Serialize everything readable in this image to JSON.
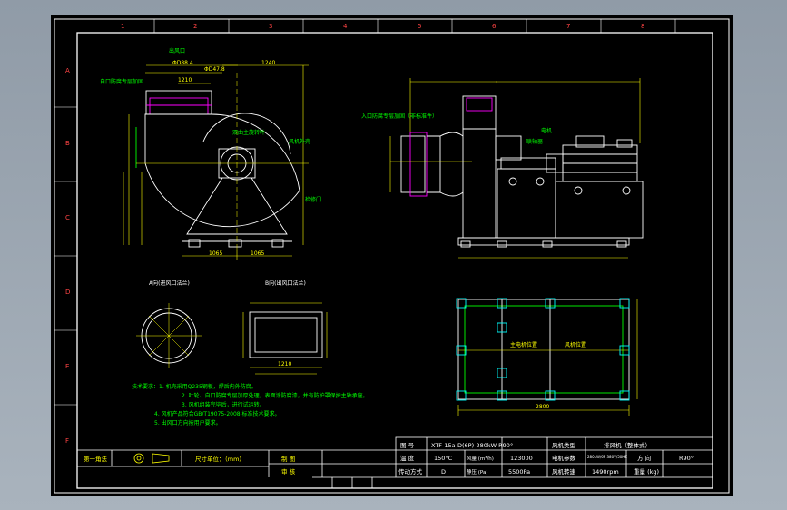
{
  "zones": {
    "columns": [
      "1",
      "2",
      "3",
      "4",
      "5",
      "6",
      "7",
      "8"
    ],
    "rows": [
      "A",
      "B",
      "C",
      "D",
      "E",
      "F"
    ]
  },
  "side_view": {
    "dims": [
      "ΦD88.4",
      "ΦD47.8",
      "1240",
      "1210"
    ],
    "notes": [
      "出风口",
      "自口防腐专层加固",
      "双曲主旋转叶",
      "风机外壳",
      "检修门"
    ],
    "base_dims": [
      "1065",
      "1065"
    ]
  },
  "front_view": {
    "notes": [
      "入口防腐专层加固（非标准件）",
      "联轴器",
      "电机"
    ]
  },
  "detail_a": {
    "title": "A向(进风口法兰)"
  },
  "detail_b": {
    "title": "B向(出风口法兰)",
    "dim": "1210"
  },
  "plan_view": {
    "labels": [
      "主电机位置",
      "风机位置"
    ],
    "dim": "2800"
  },
  "tech_notes": {
    "title": "技术要求",
    "lines": [
      "技术要求：1. 机壳采用Q235钢板，焊后内外防腐。",
      "2. 叶轮、自口防腐专层加厚处理，表面涂防腐漆，并有防护罩保护主轴承座。",
      "3. 风机组装完毕后，进行试运转。",
      "4. 风机产品符合GB/T19075-2008 标准技术要求。",
      "5. 出风口方向按用户要求。"
    ]
  },
  "title_block": {
    "left_label": "第一角法",
    "unit_label": "尺寸单位：（mm）",
    "drawn": "制 图",
    "checked": "审 核",
    "rows": [
      {
        "k1": "图 号",
        "v1": "XTF-15a-D(6P)-280kW-R90°",
        "k2": "风机类型",
        "v2": "排风机（整体式）"
      },
      {
        "k1": "温 度",
        "v1": "150°C",
        "k2": "风量 (m³/h)",
        "v2": "123000",
        "k3": "电机参数",
        "v3": "280kW/6P 380V/50HZ",
        "k4": "方 向",
        "v4": "R90°"
      },
      {
        "k1": "传动方式",
        "v1": "D",
        "k2": "静压 (Pa)",
        "v2": "5500Pa",
        "k3": "风机转速",
        "v3": "1490rpm",
        "k4": "重量 (kg)",
        "v4": ""
      }
    ]
  },
  "colors": {
    "background": "#000000",
    "frame": "#ffffff",
    "dimension": "#ffff00",
    "annotation": "#00ff00",
    "cyan": "#00ffff",
    "magenta": "#ff00ff"
  }
}
